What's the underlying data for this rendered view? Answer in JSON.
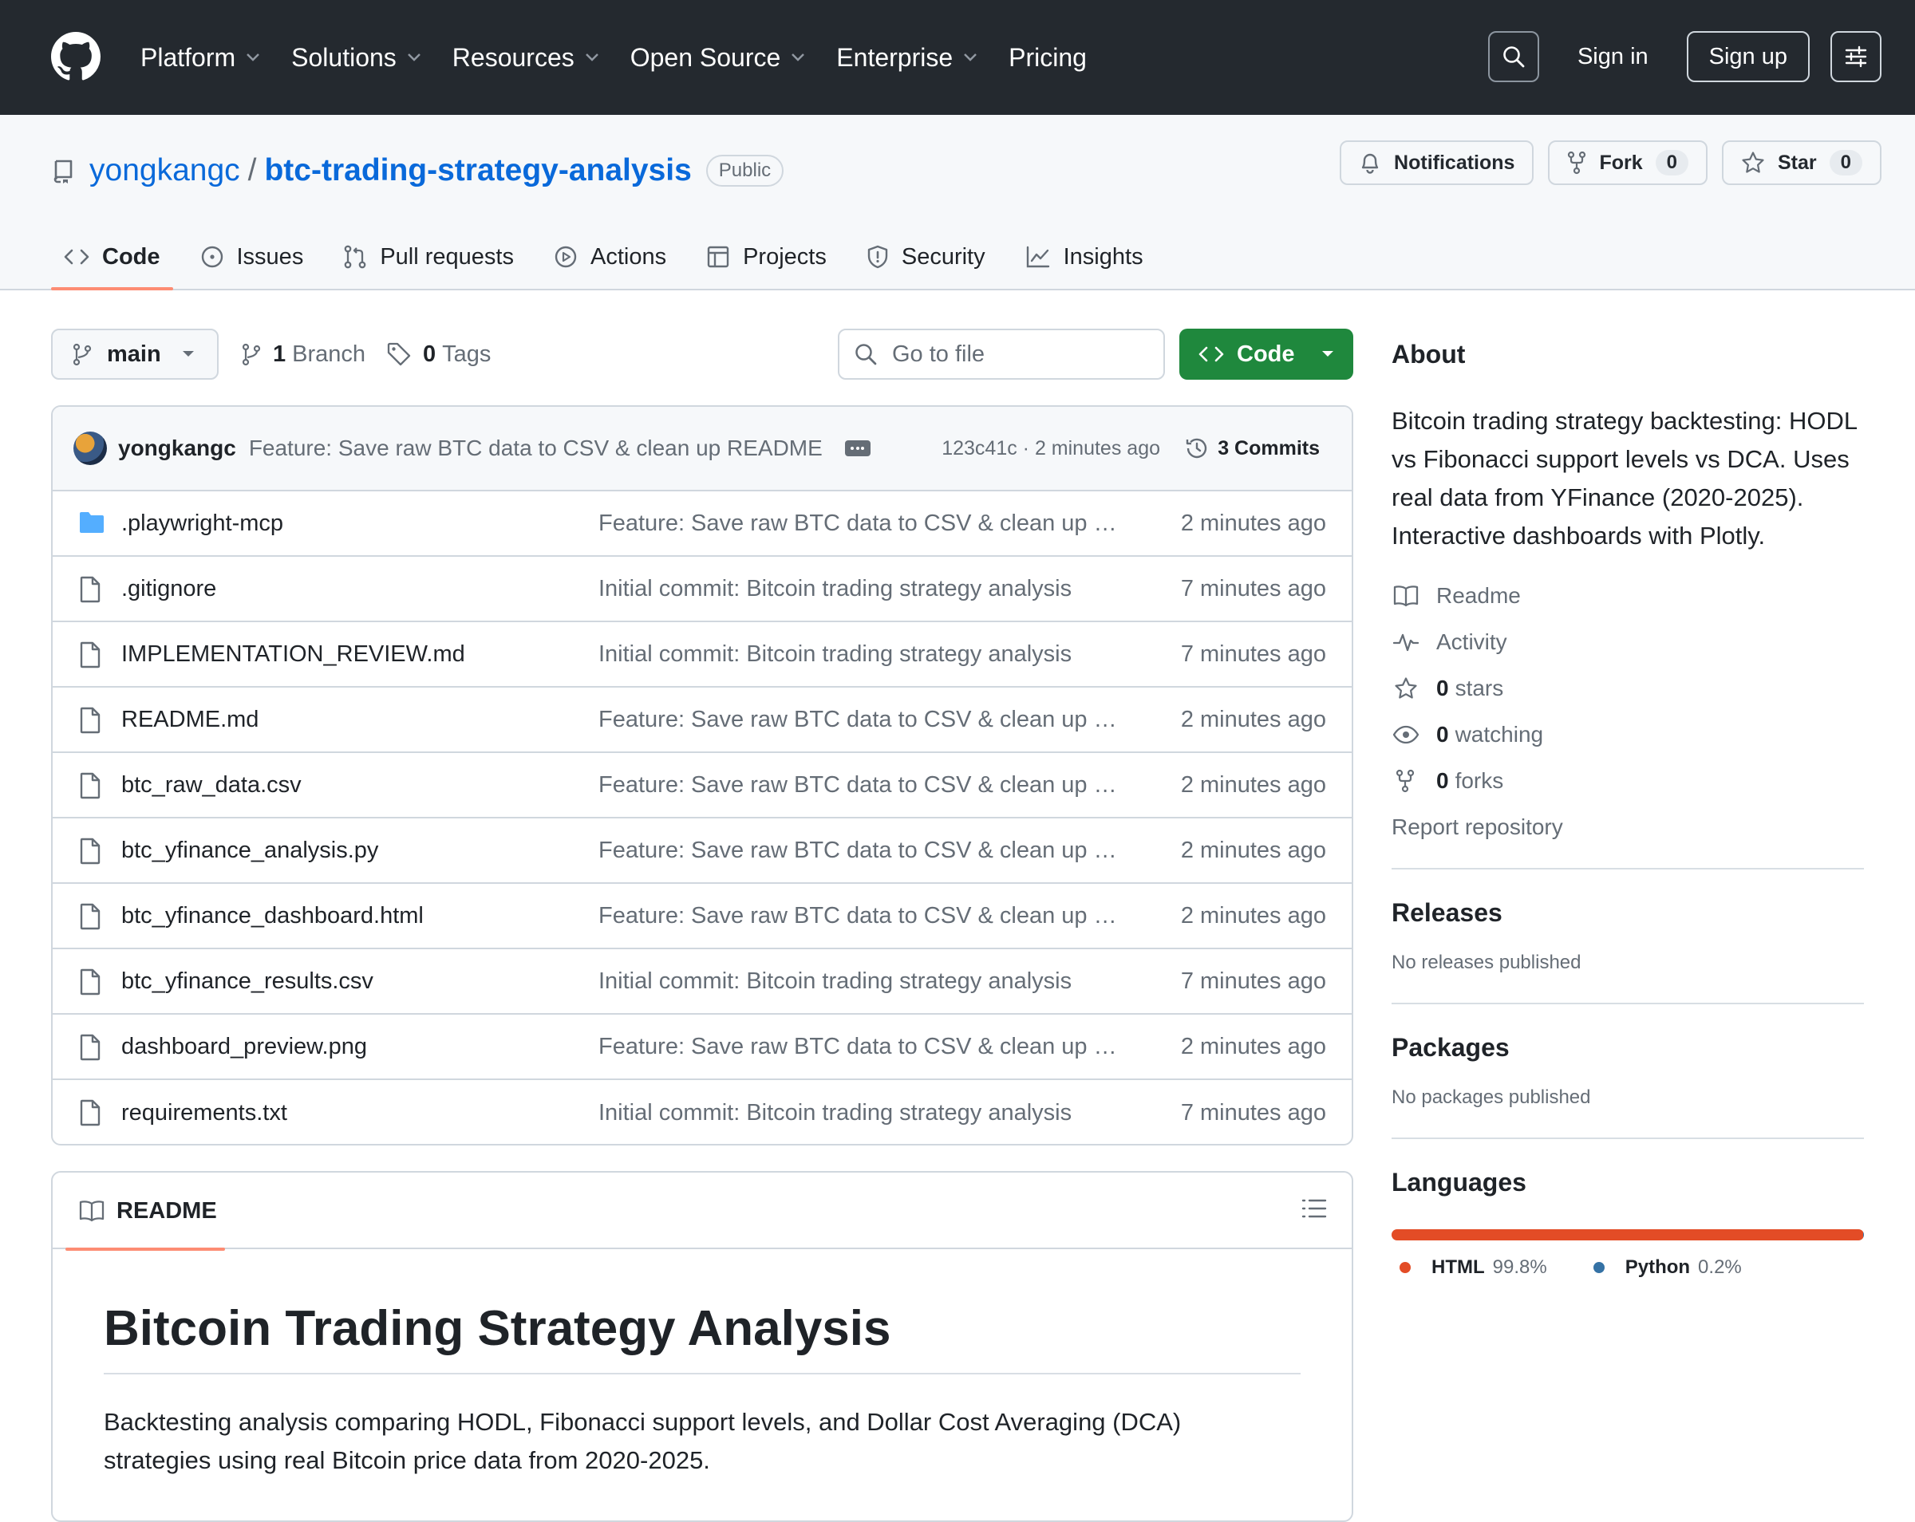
{
  "topnav": {
    "items": [
      {
        "label": "Platform",
        "dropdown": true
      },
      {
        "label": "Solutions",
        "dropdown": true
      },
      {
        "label": "Resources",
        "dropdown": true
      },
      {
        "label": "Open Source",
        "dropdown": true
      },
      {
        "label": "Enterprise",
        "dropdown": true
      },
      {
        "label": "Pricing",
        "dropdown": false
      }
    ],
    "sign_in": "Sign in",
    "sign_up": "Sign up"
  },
  "repo": {
    "owner": "yongkangc",
    "separator": "/",
    "name": "btc-trading-strategy-analysis",
    "visibility": "Public",
    "notifications_label": "Notifications",
    "fork_label": "Fork",
    "fork_count": "0",
    "star_label": "Star",
    "star_count": "0"
  },
  "tabs": [
    {
      "label": "Code",
      "icon": "code-icon",
      "active": true
    },
    {
      "label": "Issues",
      "icon": "issue-icon",
      "active": false
    },
    {
      "label": "Pull requests",
      "icon": "pull-request-icon",
      "active": false
    },
    {
      "label": "Actions",
      "icon": "play-icon",
      "active": false
    },
    {
      "label": "Projects",
      "icon": "table-icon",
      "active": false
    },
    {
      "label": "Security",
      "icon": "shield-icon",
      "active": false
    },
    {
      "label": "Insights",
      "icon": "graph-icon",
      "active": false
    }
  ],
  "branchbar": {
    "branch": "main",
    "branch_count": "1",
    "branch_label": "Branch",
    "tag_count": "0",
    "tag_label": "Tags",
    "goto_placeholder": "Go to file",
    "code_button": "Code"
  },
  "latest_commit": {
    "author": "yongkangc",
    "message": "Feature: Save raw BTC data to CSV & clean up README",
    "meta": "123c41c · 2 minutes ago",
    "commits_label": "3 Commits"
  },
  "files": [
    {
      "name": ".playwright-mcp",
      "type": "folder",
      "message": "Feature: Save raw BTC data to CSV & clean up README",
      "time": "2 minutes ago"
    },
    {
      "name": ".gitignore",
      "type": "file",
      "message": "Initial commit: Bitcoin trading strategy analysis",
      "time": "7 minutes ago"
    },
    {
      "name": "IMPLEMENTATION_REVIEW.md",
      "type": "file",
      "message": "Initial commit: Bitcoin trading strategy analysis",
      "time": "7 minutes ago"
    },
    {
      "name": "README.md",
      "type": "file",
      "message": "Feature: Save raw BTC data to CSV & clean up README",
      "time": "2 minutes ago"
    },
    {
      "name": "btc_raw_data.csv",
      "type": "file",
      "message": "Feature: Save raw BTC data to CSV & clean up README",
      "time": "2 minutes ago"
    },
    {
      "name": "btc_yfinance_analysis.py",
      "type": "file",
      "message": "Feature: Save raw BTC data to CSV & clean up README",
      "time": "2 minutes ago"
    },
    {
      "name": "btc_yfinance_dashboard.html",
      "type": "file",
      "message": "Feature: Save raw BTC data to CSV & clean up README",
      "time": "2 minutes ago"
    },
    {
      "name": "btc_yfinance_results.csv",
      "type": "file",
      "message": "Initial commit: Bitcoin trading strategy analysis",
      "time": "7 minutes ago"
    },
    {
      "name": "dashboard_preview.png",
      "type": "file",
      "message": "Feature: Save raw BTC data to CSV & clean up README",
      "time": "2 minutes ago"
    },
    {
      "name": "requirements.txt",
      "type": "file",
      "message": "Initial commit: Bitcoin trading strategy analysis",
      "time": "7 minutes ago"
    }
  ],
  "readme": {
    "tab_label": "README",
    "title": "Bitcoin Trading Strategy Analysis",
    "intro": "Backtesting analysis comparing HODL, Fibonacci support levels, and Dollar Cost Averaging (DCA) strategies using real Bitcoin price data from 2020-2025."
  },
  "about": {
    "title": "About",
    "description": "Bitcoin trading strategy backtesting: HODL vs Fibonacci support levels vs DCA. Uses real data from YFinance (2020-2025). Interactive dashboards with Plotly.",
    "links": [
      {
        "icon": "book-icon",
        "count": "",
        "label": "Readme"
      },
      {
        "icon": "pulse-icon",
        "count": "",
        "label": "Activity"
      },
      {
        "icon": "star-icon",
        "count": "0",
        "label": "stars"
      },
      {
        "icon": "eye-icon",
        "count": "0",
        "label": "watching"
      },
      {
        "icon": "fork-icon",
        "count": "0",
        "label": "forks"
      }
    ],
    "report": "Report repository"
  },
  "releases": {
    "title": "Releases",
    "note": "No releases published"
  },
  "packages": {
    "title": "Packages",
    "note": "No packages published"
  },
  "languages": {
    "title": "Languages",
    "items": [
      {
        "name": "HTML",
        "percent": "99.8%",
        "value": 99.8,
        "color": "#e34c26"
      },
      {
        "name": "Python",
        "percent": "0.2%",
        "value": 0.2,
        "color": "#3572a5"
      }
    ]
  }
}
